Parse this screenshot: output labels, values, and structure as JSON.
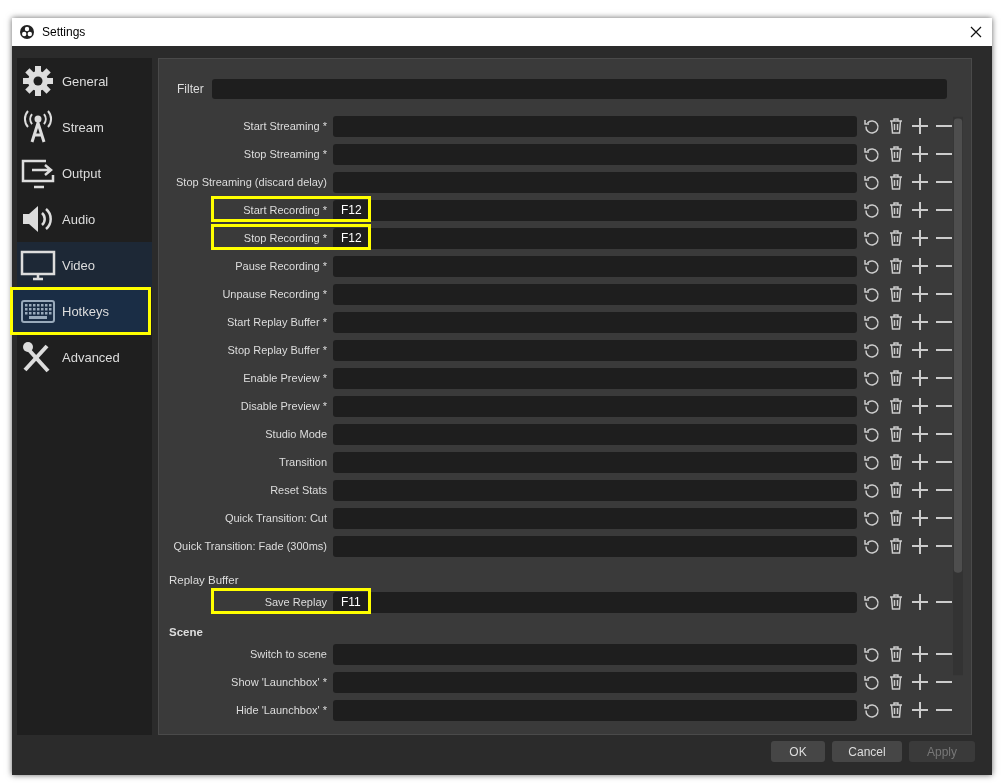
{
  "window": {
    "title": "Settings"
  },
  "sidebar": {
    "items": [
      {
        "label": "General",
        "selected": false,
        "hovered": false,
        "highlighted": false
      },
      {
        "label": "Stream",
        "selected": false,
        "hovered": false,
        "highlighted": false
      },
      {
        "label": "Output",
        "selected": false,
        "hovered": false,
        "highlighted": false
      },
      {
        "label": "Audio",
        "selected": false,
        "hovered": false,
        "highlighted": false
      },
      {
        "label": "Video",
        "selected": false,
        "hovered": true,
        "highlighted": false
      },
      {
        "label": "Hotkeys",
        "selected": true,
        "hovered": false,
        "highlighted": true
      },
      {
        "label": "Advanced",
        "selected": false,
        "hovered": false,
        "highlighted": false
      }
    ]
  },
  "filter": {
    "label": "Filter"
  },
  "sections": [
    {
      "kind": "plain",
      "rows": [
        {
          "label": "Start Streaming *",
          "value": "",
          "highlighted": false
        },
        {
          "label": "Stop Streaming *",
          "value": "",
          "highlighted": false
        },
        {
          "label": "Stop Streaming (discard delay)",
          "value": "",
          "highlighted": false
        },
        {
          "label": "Start Recording *",
          "value": "F12",
          "highlighted": true
        },
        {
          "label": "Stop Recording *",
          "value": "F12",
          "highlighted": true
        },
        {
          "label": "Pause Recording *",
          "value": "",
          "highlighted": false
        },
        {
          "label": "Unpause Recording *",
          "value": "",
          "highlighted": false
        },
        {
          "label": "Start Replay Buffer *",
          "value": "",
          "highlighted": false
        },
        {
          "label": "Stop Replay Buffer *",
          "value": "",
          "highlighted": false
        },
        {
          "label": "Enable Preview *",
          "value": "",
          "highlighted": false
        },
        {
          "label": "Disable Preview *",
          "value": "",
          "highlighted": false
        },
        {
          "label": "Studio Mode",
          "value": "",
          "highlighted": false
        },
        {
          "label": "Transition",
          "value": "",
          "highlighted": false
        },
        {
          "label": "Reset Stats",
          "value": "",
          "highlighted": false
        },
        {
          "label": "Quick Transition: Cut",
          "value": "",
          "highlighted": false
        },
        {
          "label": "Quick Transition: Fade (300ms)",
          "value": "",
          "highlighted": false
        }
      ]
    },
    {
      "kind": "subheading",
      "heading": "Replay Buffer",
      "rows": [
        {
          "label": "Save Replay",
          "value": "F11",
          "highlighted": true
        }
      ]
    },
    {
      "kind": "heading",
      "heading": "Scene",
      "rows": [
        {
          "label": "Switch to scene",
          "value": "",
          "highlighted": false
        },
        {
          "label": "Show 'Launchbox' *",
          "value": "",
          "highlighted": false
        },
        {
          "label": "Hide 'Launchbox' *",
          "value": "",
          "highlighted": false
        }
      ]
    }
  ],
  "buttons": [
    {
      "label": "OK",
      "disabled": false
    },
    {
      "label": "Cancel",
      "disabled": false
    },
    {
      "label": "Apply",
      "disabled": true
    }
  ]
}
